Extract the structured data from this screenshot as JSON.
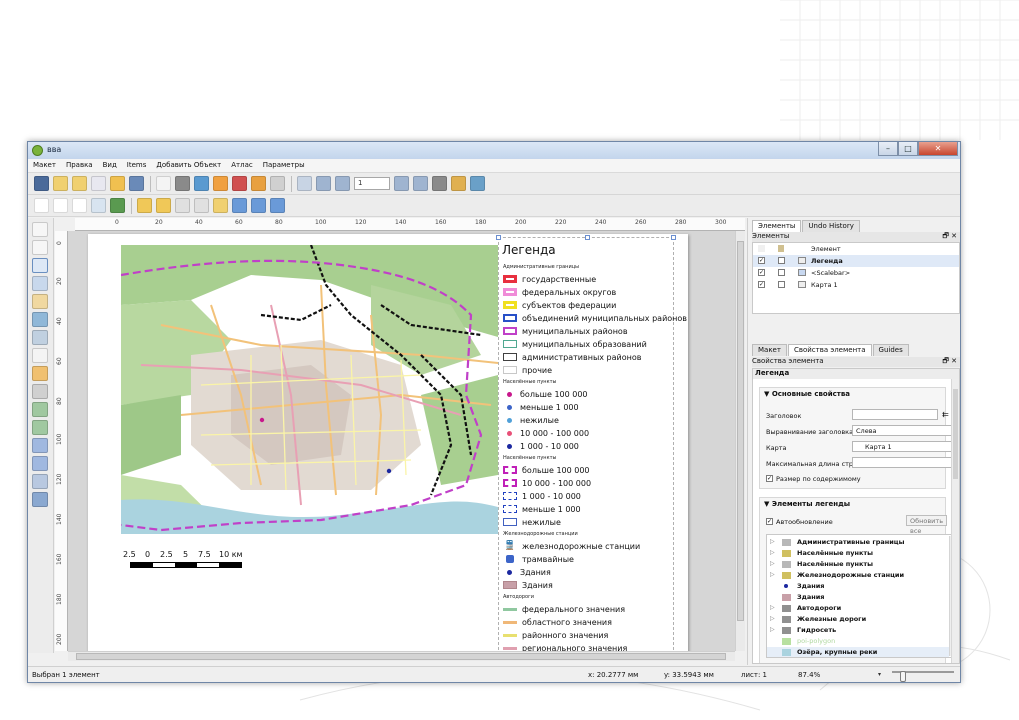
{
  "window": {
    "title": "вва",
    "minimize": "–",
    "maximize": "□",
    "close": "✕"
  },
  "menu": [
    "Макет",
    "Правка",
    "Вид",
    "Items",
    "Добавить Объект",
    "Атлас",
    "Параметры"
  ],
  "toolbar": {
    "page_number": "1"
  },
  "rulers": {
    "horizontal": [
      "0",
      "20",
      "40",
      "60",
      "80",
      "100",
      "120",
      "140",
      "160",
      "180",
      "200",
      "220",
      "240",
      "260",
      "280",
      "300"
    ],
    "vertical": [
      "0",
      "20",
      "40",
      "60",
      "80",
      "100",
      "120",
      "140",
      "160",
      "180",
      "200"
    ]
  },
  "legend": {
    "title": "Легенда",
    "groups": [
      {
        "title": "Административные границы",
        "items": [
          {
            "label": "государственные",
            "type": "box",
            "stroke": "#e8303f",
            "fill": "#ffffff",
            "width": 3
          },
          {
            "label": "федеральных округов",
            "type": "box",
            "stroke": "#f08cd8",
            "fill": "#ffffff",
            "width": 3
          },
          {
            "label": "субъектов федерации",
            "type": "box",
            "stroke": "#f0e020",
            "fill": "#ffffff",
            "width": 3
          },
          {
            "label": "объединений муниципальных районов",
            "type": "box",
            "stroke": "#2850c8",
            "fill": "#ffffff",
            "width": 2
          },
          {
            "label": "муниципальных районов",
            "type": "box",
            "stroke": "#c040c8",
            "fill": "#ffffff",
            "width": 2
          },
          {
            "label": "муниципальных образований",
            "type": "box",
            "stroke": "#50a890",
            "fill": "#ffffff",
            "width": 1
          },
          {
            "label": "административных  районов",
            "type": "box",
            "stroke": "#404040",
            "fill": "#ffffff",
            "width": 1
          },
          {
            "label": "прочие",
            "type": "box",
            "stroke": "#c8c8c8",
            "fill": "#ffffff",
            "width": 1
          }
        ]
      },
      {
        "title": "Населённые пункты",
        "items": [
          {
            "label": "больше 100 000",
            "type": "dot",
            "fill": "#c8188c"
          },
          {
            "label": "меньше 1 000",
            "type": "dot",
            "fill": "#3c64c8"
          },
          {
            "label": "нежилые",
            "type": "dot",
            "fill": "#50a0d8"
          },
          {
            "label": "10 000 - 100 000",
            "type": "dot",
            "fill": "#e85078"
          },
          {
            "label": "1 000 - 10 000",
            "type": "dot",
            "fill": "#1c28a0"
          }
        ]
      },
      {
        "title": "Населённые пункты",
        "items": [
          {
            "label": "больше 100 000",
            "type": "dashbox",
            "stroke": "#c020b8",
            "fill": "#ffffff",
            "width": 2
          },
          {
            "label": "10 000 - 100 000",
            "type": "dashbox",
            "stroke": "#c020b8",
            "fill": "#ffffff",
            "width": 2
          },
          {
            "label": "1 000 - 10 000",
            "type": "dashbox",
            "stroke": "#2040c0",
            "fill": "#ffffff",
            "width": 1
          },
          {
            "label": "меньше 1 000",
            "type": "dashbox",
            "stroke": "#2040c0",
            "fill": "#ffffff",
            "width": 1
          },
          {
            "label": "нежилые",
            "type": "box",
            "stroke": "#4060c0",
            "fill": "#ffffff",
            "width": 1
          }
        ]
      },
      {
        "title": "Железнодорожные станции",
        "items": [
          {
            "label": "железнодорожные станции",
            "type": "train",
            "fill": "#222222"
          },
          {
            "label": "трамвайные",
            "type": "tram",
            "fill": "#3c64c8"
          },
          {
            "label": "Здания",
            "type": "dot",
            "fill": "#1c28a0"
          },
          {
            "label": "Здания",
            "type": "fillbox",
            "stroke": "#b0868c",
            "fill": "#c8a0a8",
            "width": 1
          }
        ]
      },
      {
        "title": "Автодороги",
        "items": [
          {
            "label": "федерального значения",
            "type": "line",
            "stroke": "#90c8a0",
            "width": 3
          },
          {
            "label": "областного значения",
            "type": "line",
            "stroke": "#f0b878",
            "width": 3
          },
          {
            "label": "районного значения",
            "type": "line",
            "stroke": "#e8e070",
            "width": 3
          },
          {
            "label": "регионального значения",
            "type": "line",
            "stroke": "#e0a0b0",
            "width": 3
          }
        ]
      }
    ]
  },
  "scalebar": {
    "labels": [
      "2.5",
      "0",
      "2.5",
      "5",
      "7.5",
      "10 км"
    ]
  },
  "status": {
    "selection": "Выбран 1 элемент",
    "x": "x: 20.2777 мм",
    "y": "y: 33.5943 мм",
    "page": "лист: 1",
    "zoom": "87.4%"
  },
  "panel": {
    "top_tabs": [
      "Элементы",
      "Undo History"
    ],
    "items_header": "Элементы",
    "dock_controls": "🗗 ✕",
    "items_col": "Элемент",
    "items": [
      {
        "label": "Легенда",
        "checked": true
      },
      {
        "label": "<Scalebar>",
        "checked": true
      },
      {
        "label": "Карта 1",
        "checked": true
      }
    ],
    "bottom_tabs": [
      "Макет",
      "Свойства элемента",
      "Guides"
    ],
    "props_header": "Свойства элемента",
    "props_subtitle": "Легенда",
    "main_group": "Основные свойства",
    "title_label": "Заголовок",
    "title_value": "",
    "align_label": "Выравнивание заголовка",
    "align_value": "Слева",
    "map_label": "Карта",
    "map_value": "Карта 1",
    "maxlen_label": "Максимальная длина строк",
    "maxlen_value": "",
    "fit_label": "Размер по содержимому",
    "legend_items_group": "Элементы легенды",
    "autoupdate_label": "Автообновление",
    "update_all": "Обновить все",
    "tree": [
      {
        "label": "Административные границы",
        "bold": true,
        "icon": "layer-group-icon"
      },
      {
        "label": "Населённые пункты",
        "bold": true,
        "icon": "point-layer-icon"
      },
      {
        "label": "Населённые пункты",
        "bold": true,
        "icon": "layer-group-icon"
      },
      {
        "label": "Железнодорожные станции",
        "bold": true,
        "icon": "point-layer-icon"
      },
      {
        "label": "Здания",
        "bold": true,
        "icon": "point-icon"
      },
      {
        "label": "Здания",
        "bold": true,
        "icon": "polygon-icon"
      },
      {
        "label": "Автодороги",
        "bold": true,
        "icon": "line-layer-icon"
      },
      {
        "label": "Железные дороги",
        "bold": true,
        "icon": "line-layer-icon"
      },
      {
        "label": "Гидросеть",
        "bold": true,
        "icon": "line-layer-icon"
      },
      {
        "label": "poi-polygon",
        "bold": false,
        "icon": "polygon-icon"
      },
      {
        "label": "Озёра, крупные реки",
        "bold": true,
        "icon": "polygon-icon"
      }
    ]
  }
}
